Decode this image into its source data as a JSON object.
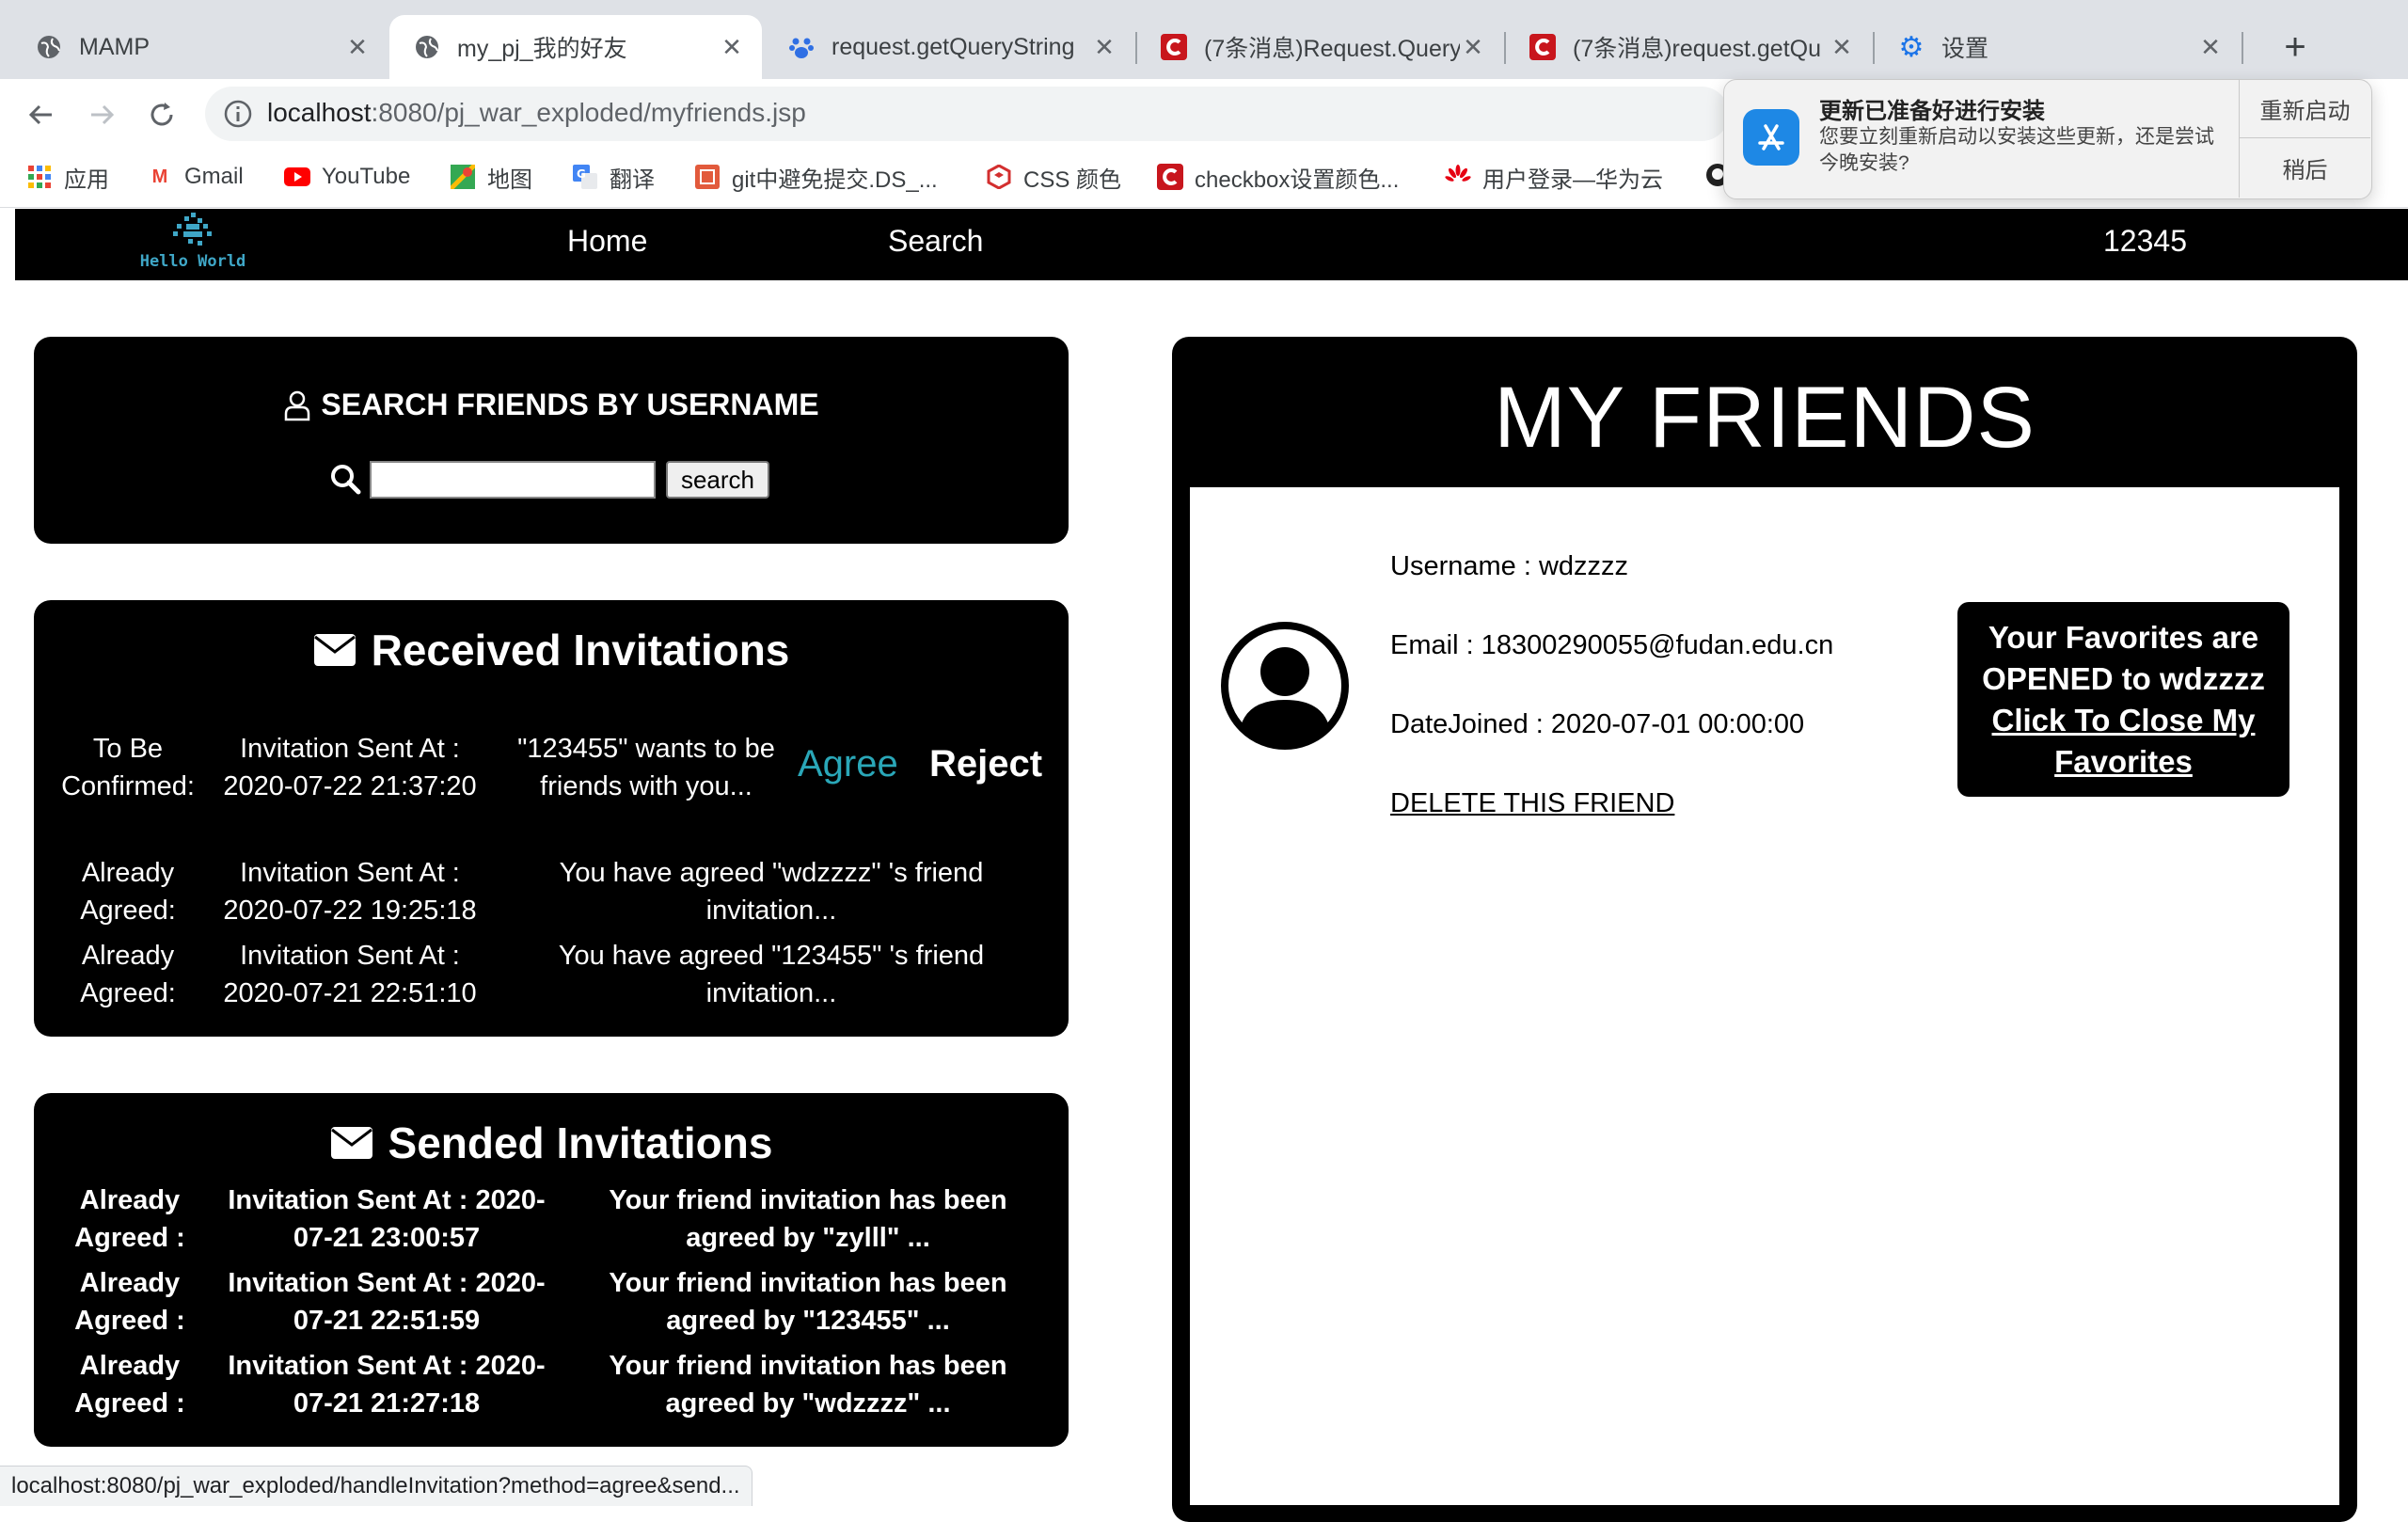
{
  "browser": {
    "tabs": [
      {
        "title": "MAMP",
        "icon": "globe-icon"
      },
      {
        "title": "my_pj_我的好友",
        "icon": "globe-icon"
      },
      {
        "title": "request.getQueryString",
        "icon": "paw-icon"
      },
      {
        "title": "(7条消息)Request.Query",
        "icon": "csdn-icon"
      },
      {
        "title": "(7条消息)request.getQu",
        "icon": "csdn-icon"
      },
      {
        "title": "设置",
        "icon": "gear-icon"
      }
    ],
    "url_host": "localhost",
    "url_rest": ":8080/pj_war_exploded/myfriends.jsp",
    "bookmarks": [
      {
        "label": "应用",
        "icon": "apps-icon"
      },
      {
        "label": "Gmail",
        "icon": "gmail-icon"
      },
      {
        "label": "YouTube",
        "icon": "youtube-icon"
      },
      {
        "label": "地图",
        "icon": "maps-icon"
      },
      {
        "label": "翻译",
        "icon": "translate-icon"
      },
      {
        "label": "git中避免提交.DS_...",
        "icon": "bookmark-icon"
      },
      {
        "label": "CSS 颜色",
        "icon": "css-icon"
      },
      {
        "label": "checkbox设置颜色...",
        "icon": "csdn-icon"
      },
      {
        "label": "用户登录—华为云",
        "icon": "huawei-icon"
      }
    ],
    "notification": {
      "title": "更新已准备好进行安装",
      "body": "您要立刻重新启动以安装这些更新，还是尝试今晚安装?",
      "primary": "重新启动",
      "secondary": "稍后"
    },
    "status_url": "localhost:8080/pj_war_exploded/handleInvitation?method=agree&send..."
  },
  "site": {
    "logo_text": "Hello World",
    "nav": {
      "home": "Home",
      "search": "Search",
      "user": "12345"
    }
  },
  "search_panel": {
    "title": "SEARCH FRIENDS BY USERNAME",
    "button": "search",
    "value": ""
  },
  "received": {
    "title": "Received Invitations",
    "rows": [
      {
        "status": "To Be Confirmed:",
        "sent_label": "Invitation Sent At :",
        "sent_at": "2020-07-22 21:37:20",
        "message": "\"123455\" wants to be friends with you...",
        "agree": "Agree",
        "reject": "Reject"
      },
      {
        "status": "Already Agreed:",
        "sent_label": "Invitation Sent At :",
        "sent_at": "2020-07-22 19:25:18",
        "message": "You have agreed \"wdzzzz\" 's friend invitation..."
      },
      {
        "status": "Already Agreed:",
        "sent_label": "Invitation Sent At :",
        "sent_at": "2020-07-21 22:51:10",
        "message": "You have agreed \"123455\" 's friend invitation..."
      }
    ]
  },
  "sent": {
    "title": "Sended Invitations",
    "rows": [
      {
        "status": "Already Agreed :",
        "sent": "Invitation Sent At : 2020-07-21 23:00:57",
        "message": "Your friend invitation has been agreed by \"zylll\" ..."
      },
      {
        "status": "Already Agreed :",
        "sent": "Invitation Sent At : 2020-07-21 22:51:59",
        "message": "Your friend invitation has been agreed by \"123455\" ..."
      },
      {
        "status": "Already Agreed :",
        "sent": "Invitation Sent At : 2020-07-21 21:27:18",
        "message": "Your friend invitation has been agreed by \"wdzzzz\" ..."
      }
    ]
  },
  "friends": {
    "title": "MY FRIENDS",
    "list": [
      {
        "username": "Username : wdzzzz",
        "email": "Email : 18300290055@fudan.edu.cn",
        "date_joined": "DateJoined : 2020-07-01 00:00:00",
        "delete": "DELETE THIS FRIEND",
        "fav_line1": "Your Favorites are",
        "fav_line2": "OPENED to wdzzzz",
        "fav_link": "Click To Close My Favorites"
      }
    ]
  },
  "colors": {
    "accent_agree": "#2aa7b8",
    "panel_bg": "#000000",
    "logo": "#3fa7c7"
  }
}
